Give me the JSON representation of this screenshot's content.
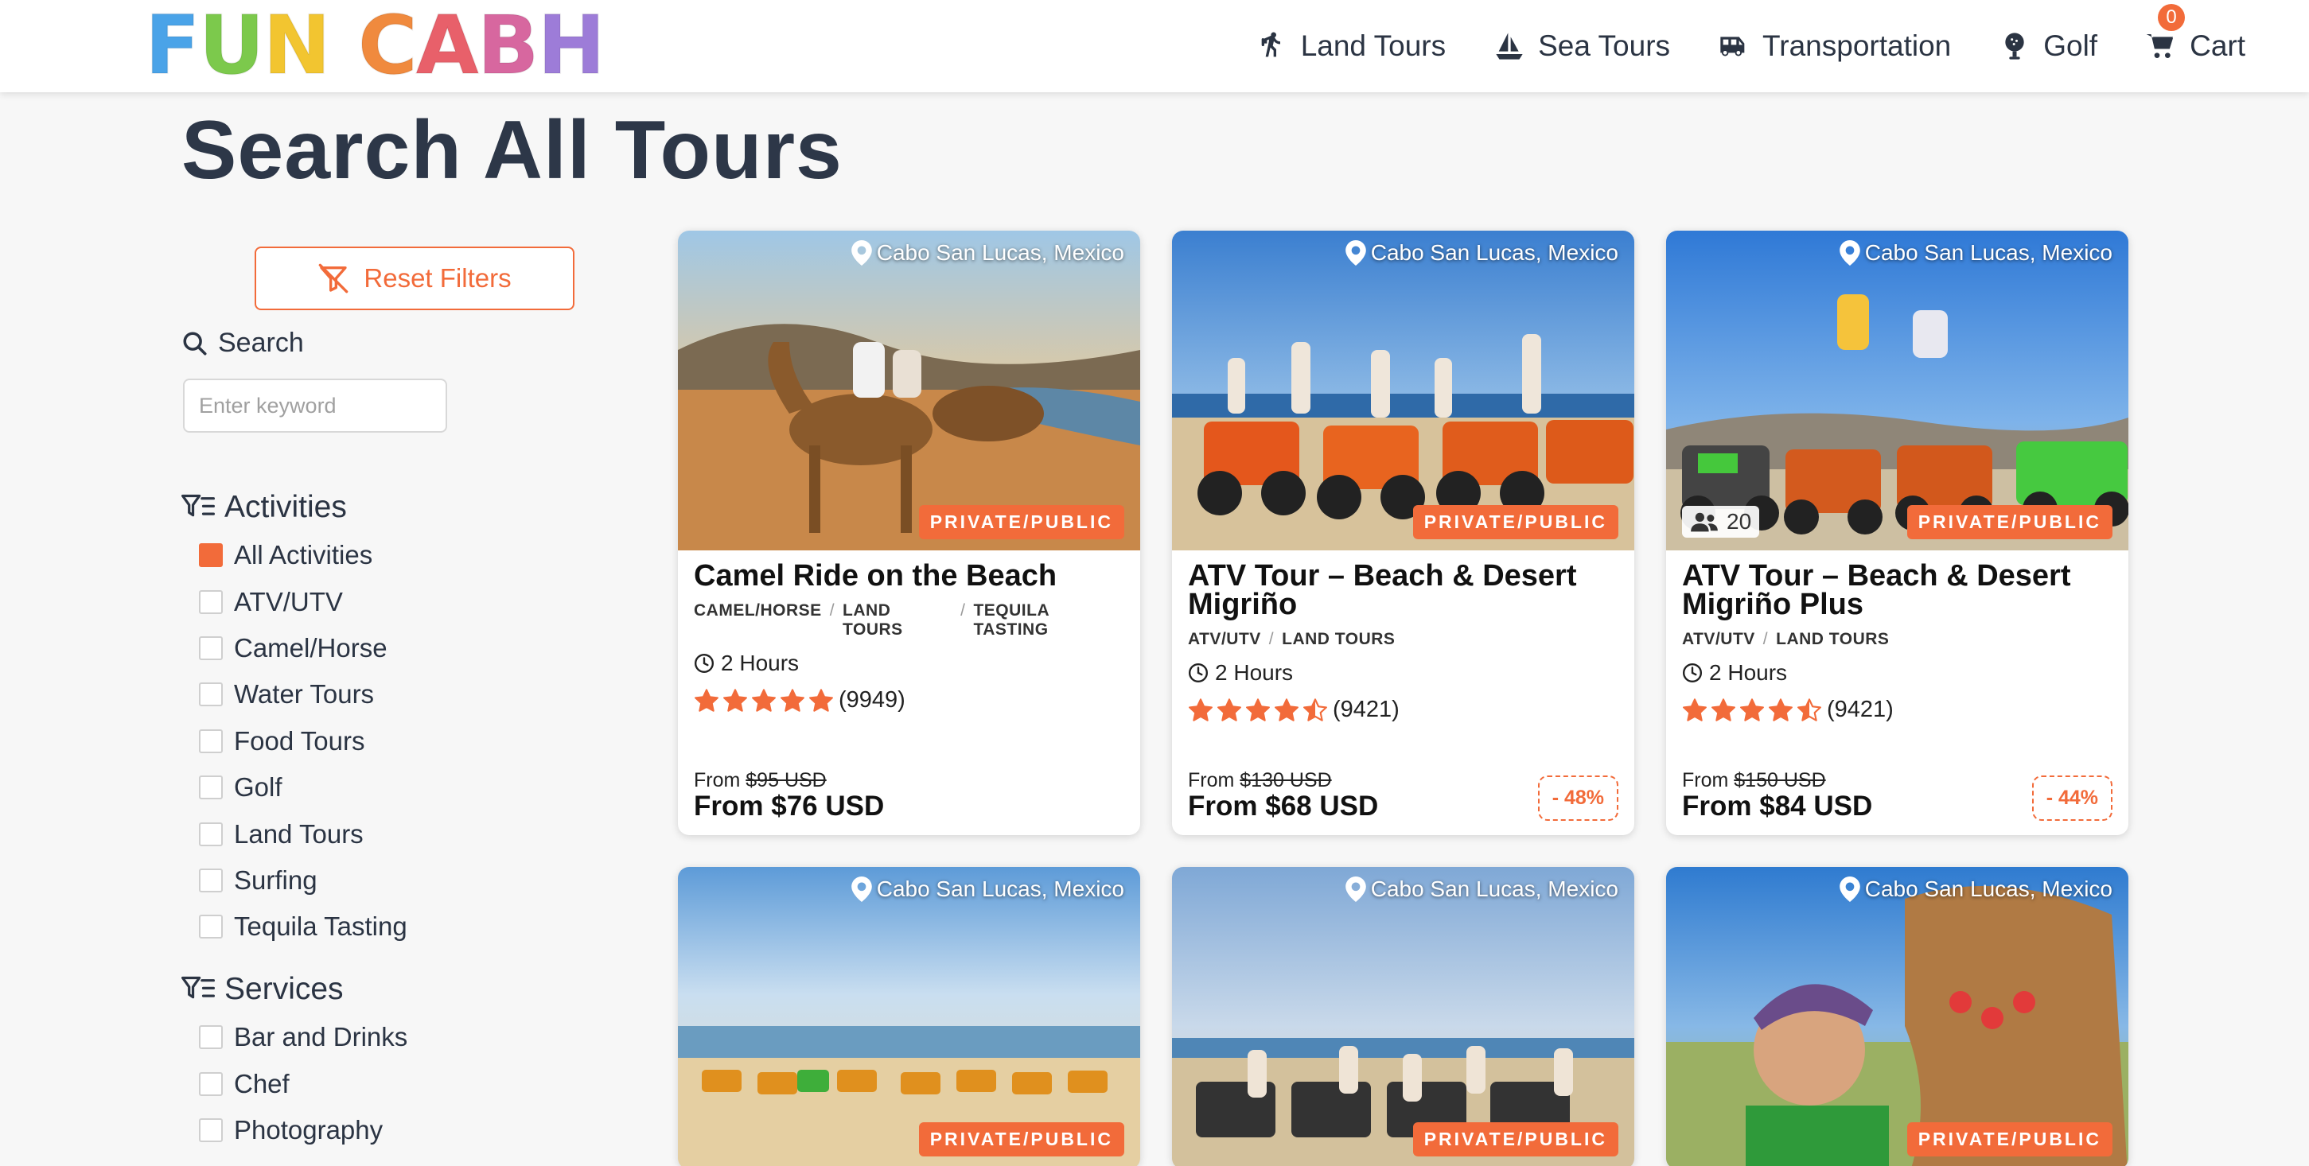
{
  "header": {
    "logo_letters": [
      {
        "ch": "F",
        "color": "#4aa3e8"
      },
      {
        "ch": "U",
        "color": "#7cc94c"
      },
      {
        "ch": "N",
        "color": "#f2c530"
      },
      {
        "ch": "C",
        "color": "#f08a3e"
      },
      {
        "ch": "A",
        "color": "#e8606a"
      },
      {
        "ch": "B",
        "color": "#d7679f"
      },
      {
        "ch": "H",
        "color": "#9d7cd8"
      }
    ],
    "nav": {
      "land": "Land Tours",
      "sea": "Sea Tours",
      "transport": "Transportation",
      "golf": "Golf",
      "cart": "Cart",
      "cart_count": "0"
    }
  },
  "page": {
    "title": "Search All Tours"
  },
  "sidebar": {
    "reset_label": "Reset Filters",
    "search_label": "Search",
    "search_placeholder": "Enter keyword",
    "activities_title": "Activities",
    "activities": [
      {
        "label": "All Activities",
        "checked": true
      },
      {
        "label": "ATV/UTV",
        "checked": false
      },
      {
        "label": "Camel/Horse",
        "checked": false
      },
      {
        "label": "Water Tours",
        "checked": false
      },
      {
        "label": "Food Tours",
        "checked": false
      },
      {
        "label": "Golf",
        "checked": false
      },
      {
        "label": "Land Tours",
        "checked": false
      },
      {
        "label": "Surfing",
        "checked": false
      },
      {
        "label": "Tequila Tasting",
        "checked": false
      }
    ],
    "services_title": "Services",
    "services": [
      {
        "label": "Bar and Drinks",
        "checked": false
      },
      {
        "label": "Chef",
        "checked": false
      },
      {
        "label": "Photography",
        "checked": false
      }
    ]
  },
  "tours": [
    {
      "location": "Cabo San Lucas, Mexico",
      "badge": "PRIVATE/PUBLIC",
      "title": "Camel Ride on the Beach",
      "categories": [
        "CAMEL/HORSE",
        "LAND TOURS",
        "TEQUILA TASTING"
      ],
      "duration": "2 Hours",
      "stars": 5,
      "reviews": "(9949)",
      "was_prefix": "From",
      "was_price": "$95 USD",
      "price": "From $76 USD",
      "discount": ""
    },
    {
      "location": "Cabo San Lucas, Mexico",
      "badge": "PRIVATE/PUBLIC",
      "title": "ATV Tour – Beach & Desert Migriño",
      "categories": [
        "ATV/UTV",
        "LAND TOURS"
      ],
      "duration": "2 Hours",
      "stars": 4.5,
      "reviews": "(9421)",
      "was_prefix": "From",
      "was_price": "$130 USD",
      "price": "From $68 USD",
      "discount": "- 48%"
    },
    {
      "location": "Cabo San Lucas, Mexico",
      "badge": "PRIVATE/PUBLIC",
      "group_size": "20",
      "title": "ATV Tour – Beach & Desert Migriño Plus",
      "categories": [
        "ATV/UTV",
        "LAND TOURS"
      ],
      "duration": "2 Hours",
      "stars": 4.5,
      "reviews": "(9421)",
      "was_prefix": "From",
      "was_price": "$150 USD",
      "price": "From $84 USD",
      "discount": "- 44%"
    },
    {
      "location": "Cabo San Lucas, Mexico",
      "badge": "PRIVATE/PUBLIC"
    },
    {
      "location": "Cabo San Lucas, Mexico",
      "badge": "PRIVATE/PUBLIC"
    },
    {
      "location": "Cabo San Lucas, Mexico",
      "badge": "PRIVATE/PUBLIC"
    }
  ],
  "colors": {
    "accent": "#f26b3a",
    "heading": "#2d3748"
  }
}
